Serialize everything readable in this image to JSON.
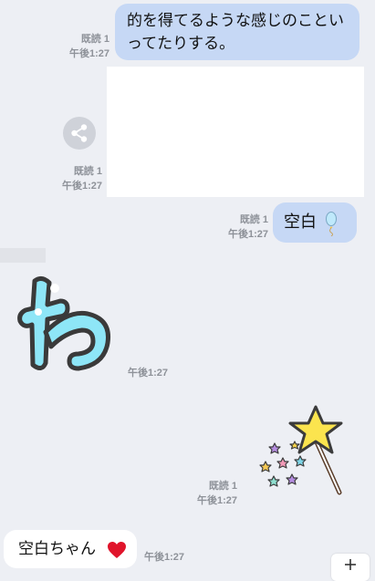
{
  "messages": [
    {
      "text": "的を得てるような感じのこといってたりする。",
      "read": "既読 1",
      "time": "午後1:27"
    },
    {
      "read": "既読 1",
      "time": "午後1:27"
    },
    {
      "text": "空白",
      "read": "既読 1",
      "time": "午後1:27"
    }
  ],
  "incoming": [
    {
      "time": "午後1:27"
    },
    {
      "read": "既読 1",
      "time": "午後1:27"
    },
    {
      "text": "空白ちゃん",
      "time": "午後1:27"
    }
  ],
  "icons": {
    "share": "share-icon",
    "balloon": "balloon-emoji-icon",
    "wa_sticker": "hiragana-wa-sticker",
    "star_wand": "star-wand-sticker",
    "heart": "heart-icon",
    "plus": "plus-icon"
  },
  "colors": {
    "background": "#edeff4",
    "outgoing_bubble": "#c6d8f5",
    "incoming_bubble": "#ffffff",
    "meta_text": "#8e9299",
    "heart": "#e0142b",
    "wa_sticker_fill": "#8ee6f7"
  }
}
